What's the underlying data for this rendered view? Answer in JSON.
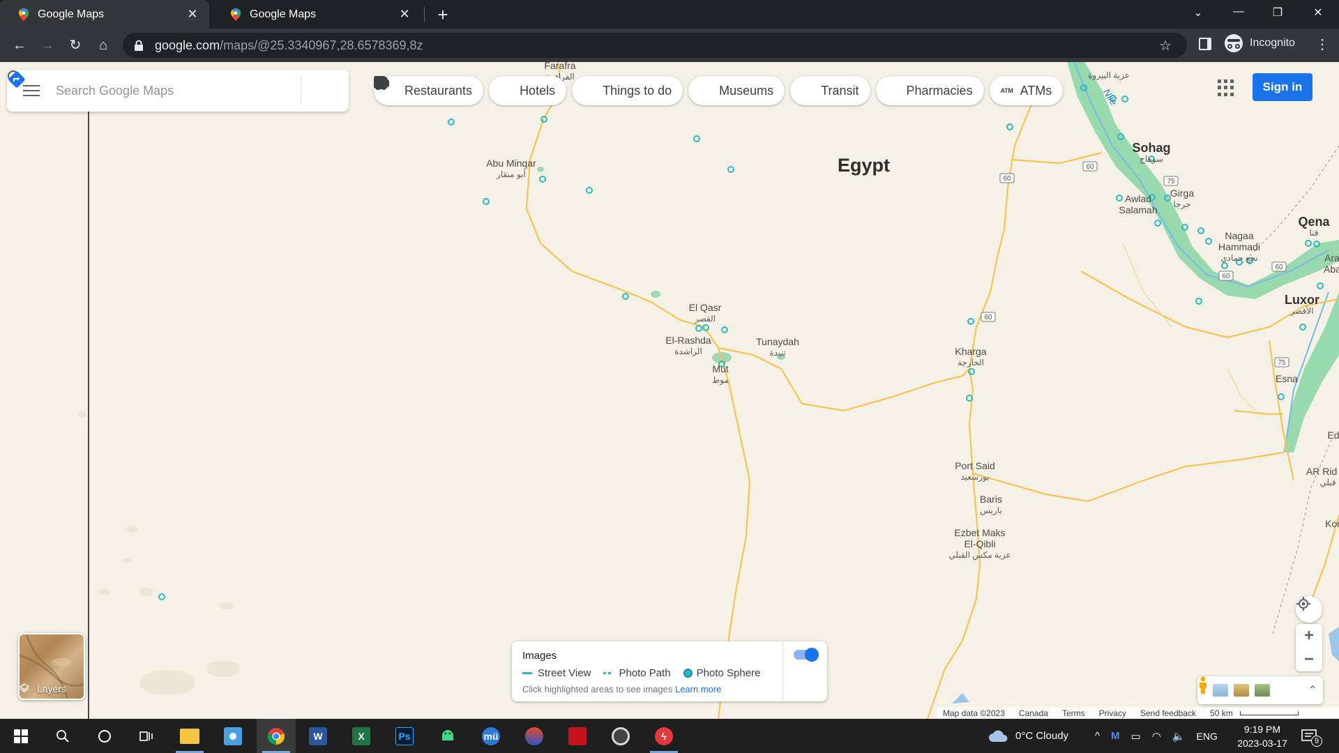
{
  "browser": {
    "tabs": [
      {
        "title": "Google Maps",
        "active": true
      },
      {
        "title": "Google Maps",
        "active": false
      }
    ],
    "url_host": "google.com",
    "url_path": "/maps/@25.3340967,28.6578369,8z",
    "profile_label": "Incognito"
  },
  "maps": {
    "search_placeholder": "Search Google Maps",
    "chips": [
      {
        "label": "Restaurants",
        "icon": "fork-knife-icon"
      },
      {
        "label": "Hotels",
        "icon": "bed-icon"
      },
      {
        "label": "Things to do",
        "icon": "camera-icon"
      },
      {
        "label": "Museums",
        "icon": "museum-icon"
      },
      {
        "label": "Transit",
        "icon": "transit-icon"
      },
      {
        "label": "Pharmacies",
        "icon": "pharmacy-icon"
      },
      {
        "label": "ATMs",
        "icon": "atm-icon"
      }
    ],
    "sign_in": "Sign in",
    "country": "Egypt",
    "places": [
      {
        "name": "Farafra",
        "ar": "الفرافرة"
      },
      {
        "name": "Abu Minqar",
        "ar": "أبو منقار"
      },
      {
        "name": "El Qasr",
        "ar": "القصر"
      },
      {
        "name": "El-Rashda",
        "ar": "الراشدة"
      },
      {
        "name": "Mut",
        "ar": "موط"
      },
      {
        "name": "Tunaydah",
        "ar": "تنيدة"
      },
      {
        "name": "Kharga",
        "ar": "الخارجة"
      },
      {
        "name": "Port Said",
        "ar": "بورسعيد"
      },
      {
        "name": "Baris",
        "ar": "باريس"
      },
      {
        "name": "Ezbet Maks El-Qibli",
        "ar": "عزبة مكس القبلي"
      },
      {
        "name": "Sohag",
        "ar": "سوهاج"
      },
      {
        "name": "Girga",
        "ar": "جرجا"
      },
      {
        "name": "Awlad Salamah",
        "ar": ""
      },
      {
        "name": "Nagaa Hammadi",
        "ar": "نجع حمادي"
      },
      {
        "name": "Qena",
        "ar": "قنا"
      },
      {
        "name": "Luxor",
        "ar": "الأقصر"
      },
      {
        "name": "Esna",
        "ar": ""
      },
      {
        "name": "Nile",
        "ar": ""
      },
      {
        "name": "AR Rid Qi",
        "ar": "قبلي"
      },
      {
        "name": "Kor",
        "ar": ""
      },
      {
        "name": "Ed",
        "ar": ""
      },
      {
        "name": "Ara Ababi",
        "ar": ""
      },
      {
        "name": "",
        "ar": "عزبة البيروة"
      }
    ],
    "road_shields": [
      "60",
      "60",
      "60",
      "75",
      "60",
      "60",
      "75",
      "60"
    ],
    "layers_label": "Layers",
    "images_panel": {
      "title": "Images",
      "street_view": "Street View",
      "photo_path": "Photo Path",
      "photo_sphere": "Photo Sphere",
      "hint": "Click highlighted areas to see images",
      "learn_more": "Learn more",
      "toggle_on": true
    },
    "attribution": {
      "map_data": "Map data ©2023",
      "region": "Canada",
      "terms": "Terms",
      "privacy": "Privacy",
      "feedback": "Send feedback",
      "scale": "50 km"
    }
  },
  "taskbar": {
    "weather": "0°C  Cloudy",
    "lang": "ENG",
    "time": "9:19 PM",
    "date": "2023-03-17",
    "notifications": "9"
  },
  "colors": {
    "land": "#f5f1e6",
    "road": "#f6c453",
    "nile_green": "#8fd6a5",
    "water": "#7ab8e8",
    "accent": "#1a73e8"
  }
}
